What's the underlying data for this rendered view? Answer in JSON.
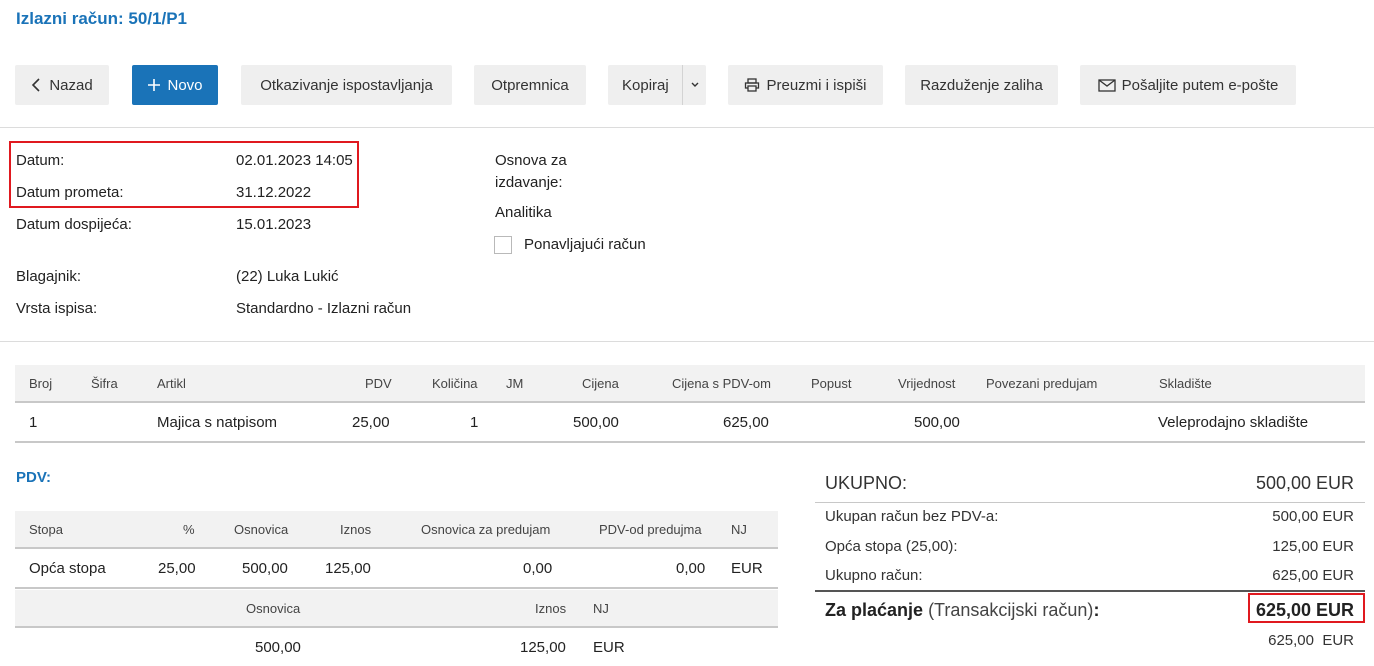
{
  "header": {
    "title": "Izlazni račun: 50/1/P1"
  },
  "toolbar": {
    "back": "Nazad",
    "new": "Novo",
    "cancel_issue": "Otkazivanje ispostavljanja",
    "delivery_note": "Otpremnica",
    "copy": "Kopiraj",
    "download_print": "Preuzmi i ispiši",
    "stock_discharge": "Razduženje zaliha",
    "send_email": "Pošaljite putem e-pošte"
  },
  "info": {
    "date_label": "Datum:",
    "date_value": "02.01.2023 14:05",
    "turnover_date_label": "Datum prometa:",
    "turnover_date_value": "31.12.2022",
    "due_date_label": "Datum dospijeća:",
    "due_date_value": "15.01.2023",
    "cashier_label": "Blagajnik:",
    "cashier_value": "(22) Luka Lukić",
    "print_type_label": "Vrsta ispisa:",
    "print_type_value": "Standardno - Izlazni račun",
    "basis_label_1": "Osnova za",
    "basis_label_2": "izdavanje:",
    "analytics_label": "Analitika",
    "recurring_label": "Ponavljajući račun"
  },
  "items": {
    "headers": [
      "Broj",
      "Šifra",
      "Artikl",
      "PDV",
      "Količina",
      "JM",
      "Cijena",
      "Cijena s PDV-om",
      "Popust",
      "Vrijednost",
      "Povezani predujam",
      "Skladište"
    ],
    "rows": [
      {
        "no": "1",
        "code": "",
        "article": "Majica s natpisom",
        "vat": "25,00",
        "qty": "1",
        "unit": "",
        "price": "500,00",
        "price_vat": "625,00",
        "discount": "",
        "value": "500,00",
        "advance": "",
        "warehouse": "Veleprodajno skladište"
      }
    ]
  },
  "vat": {
    "title": "PDV:",
    "headers": [
      "Stopa",
      "%",
      "Osnovica",
      "Iznos",
      "Osnovica za predujam",
      "PDV-od predujma",
      "NJ"
    ],
    "rows": [
      {
        "rate": "Opća stopa",
        "percent": "25,00",
        "base": "500,00",
        "amount": "125,00",
        "advance_base": "0,00",
        "advance_vat": "0,00",
        "currency": "EUR"
      }
    ],
    "summary_headers": [
      "Osnovica",
      "Iznos",
      "NJ"
    ],
    "summary_row": {
      "base": "500,00",
      "amount": "125,00",
      "currency": "EUR"
    }
  },
  "totals": {
    "total_label": "UKUPNO:",
    "total_value": "500,00 EUR",
    "net_label": "Ukupan račun bez PDV-a:",
    "net_value": "500,00 EUR",
    "std_rate_label": "Opća stopa (25,00):",
    "std_rate_value": "125,00 EUR",
    "gross_label": "Ukupno račun:",
    "gross_value": "625,00 EUR",
    "pay_label_bold": "Za plaćanje",
    "pay_label_normal": "(Transakcijski račun)",
    "pay_colon": ":",
    "pay_value": "625,00 EUR",
    "pay_sub_value": "625,00  EUR"
  },
  "colors": {
    "accent": "#1a73b8",
    "highlight": "#e0191f",
    "button_bg": "#efefef"
  }
}
